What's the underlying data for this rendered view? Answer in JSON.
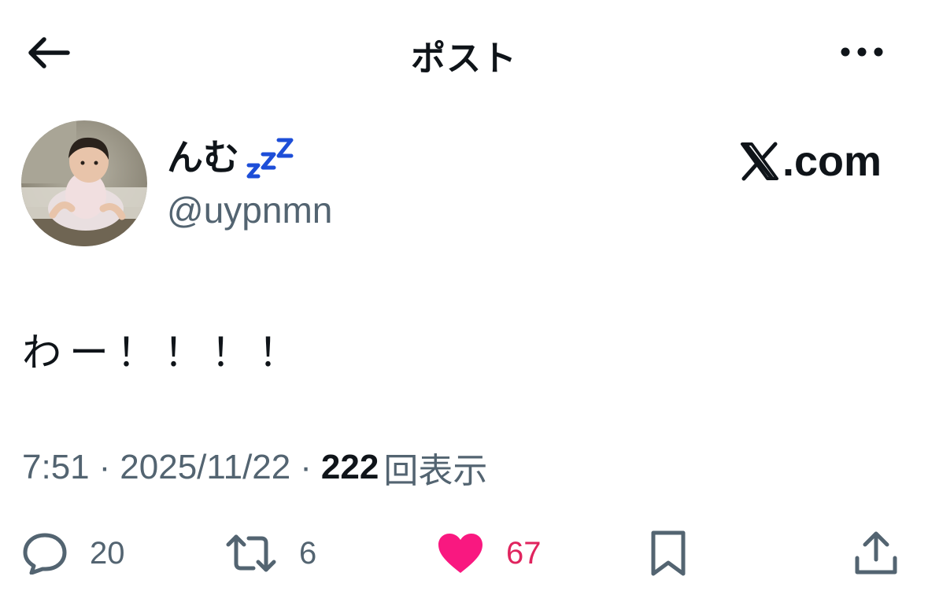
{
  "header": {
    "title": "ポスト"
  },
  "author": {
    "display_name": "んむ",
    "zzz_emoji": "ᶻᶻᶻ",
    "handle": "@uypnmn"
  },
  "source": {
    "label": ".com",
    "brand_mark": "𝕏"
  },
  "post": {
    "text": "わー！！！！",
    "time": "7:51",
    "separator": "·",
    "date": "2025/11/22",
    "views_count": "222",
    "views_label": "回表示"
  },
  "actions": {
    "reply_count": "20",
    "retweet_count": "6",
    "like_count": "67"
  },
  "colors": {
    "text_primary": "#0f1419",
    "text_secondary": "#536471",
    "like": "#f91880",
    "zzz": "#1d4ed8"
  }
}
